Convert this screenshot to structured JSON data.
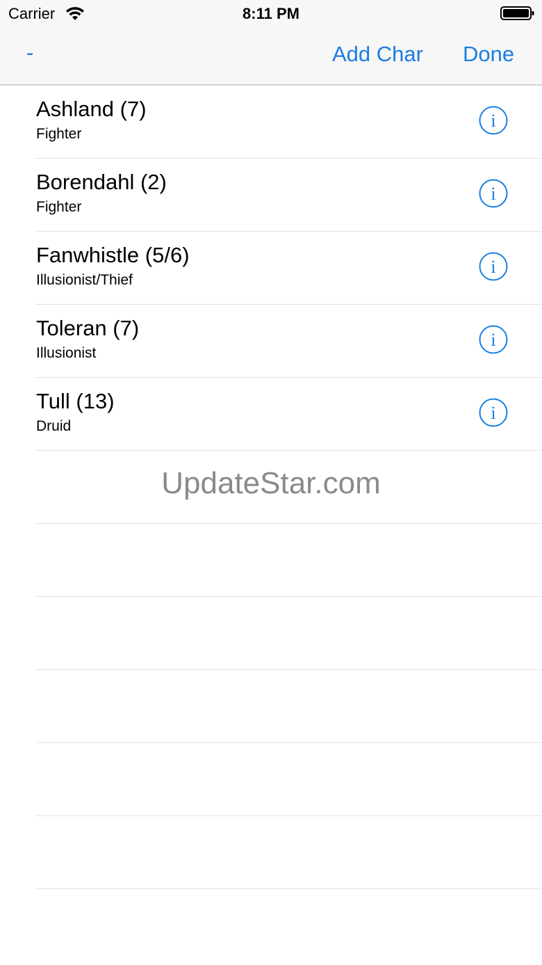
{
  "status_bar": {
    "carrier": "Carrier",
    "time": "8:11 PM",
    "wifi_icon": "wifi-icon",
    "battery_icon": "battery-icon"
  },
  "nav": {
    "minus_label": "-",
    "add_label": "Add Char",
    "done_label": "Done",
    "accent_color": "#1b7de2"
  },
  "characters": [
    {
      "title": "Ashland (7)",
      "subtitle": "Fighter"
    },
    {
      "title": "Borendahl (2)",
      "subtitle": "Fighter"
    },
    {
      "title": "Fanwhistle (5/6)",
      "subtitle": "Illusionist/Thief"
    },
    {
      "title": "Toleran (7)",
      "subtitle": "Illusionist"
    },
    {
      "title": "Tull (13)",
      "subtitle": "Druid"
    }
  ],
  "info_icon": "info-circle-icon",
  "watermark": "UpdateStar.com"
}
